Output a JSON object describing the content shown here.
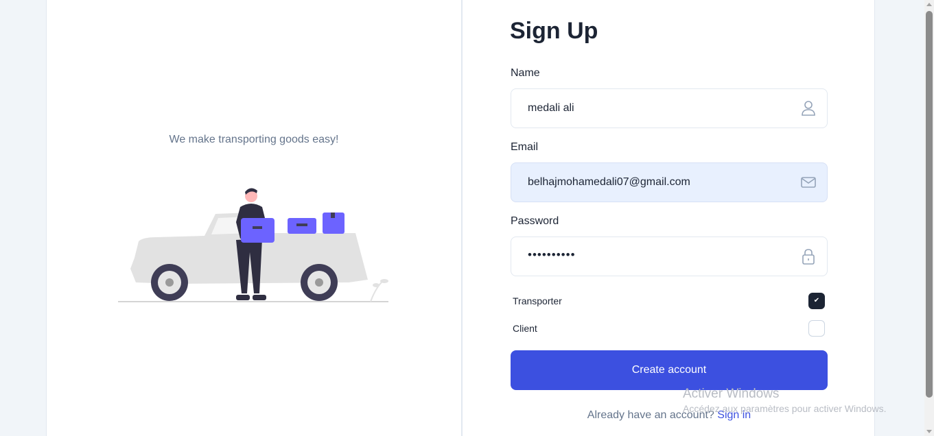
{
  "left": {
    "tagline": "We make transporting goods easy!"
  },
  "form": {
    "title": "Sign Up",
    "name": {
      "label": "Name",
      "value": "medali ali",
      "icon": "user-icon"
    },
    "email": {
      "label": "Email",
      "value": "belhajmohamedali07@gmail.com",
      "icon": "mail-icon"
    },
    "password": {
      "label": "Password",
      "value": "••••••••••",
      "icon": "lock-icon"
    },
    "roles": [
      {
        "label": "Transporter",
        "checked": true
      },
      {
        "label": "Client",
        "checked": false
      }
    ],
    "submit_label": "Create account",
    "footer_text": "Already have an account?",
    "footer_link": "Sign in"
  },
  "watermark": {
    "line1": "Activer Windows",
    "line2": "Accédez aux paramètres pour activer Windows."
  },
  "colors": {
    "primary": "#3c50e0",
    "dark": "#1c2434",
    "accent_illustration": "#6c63ff"
  }
}
